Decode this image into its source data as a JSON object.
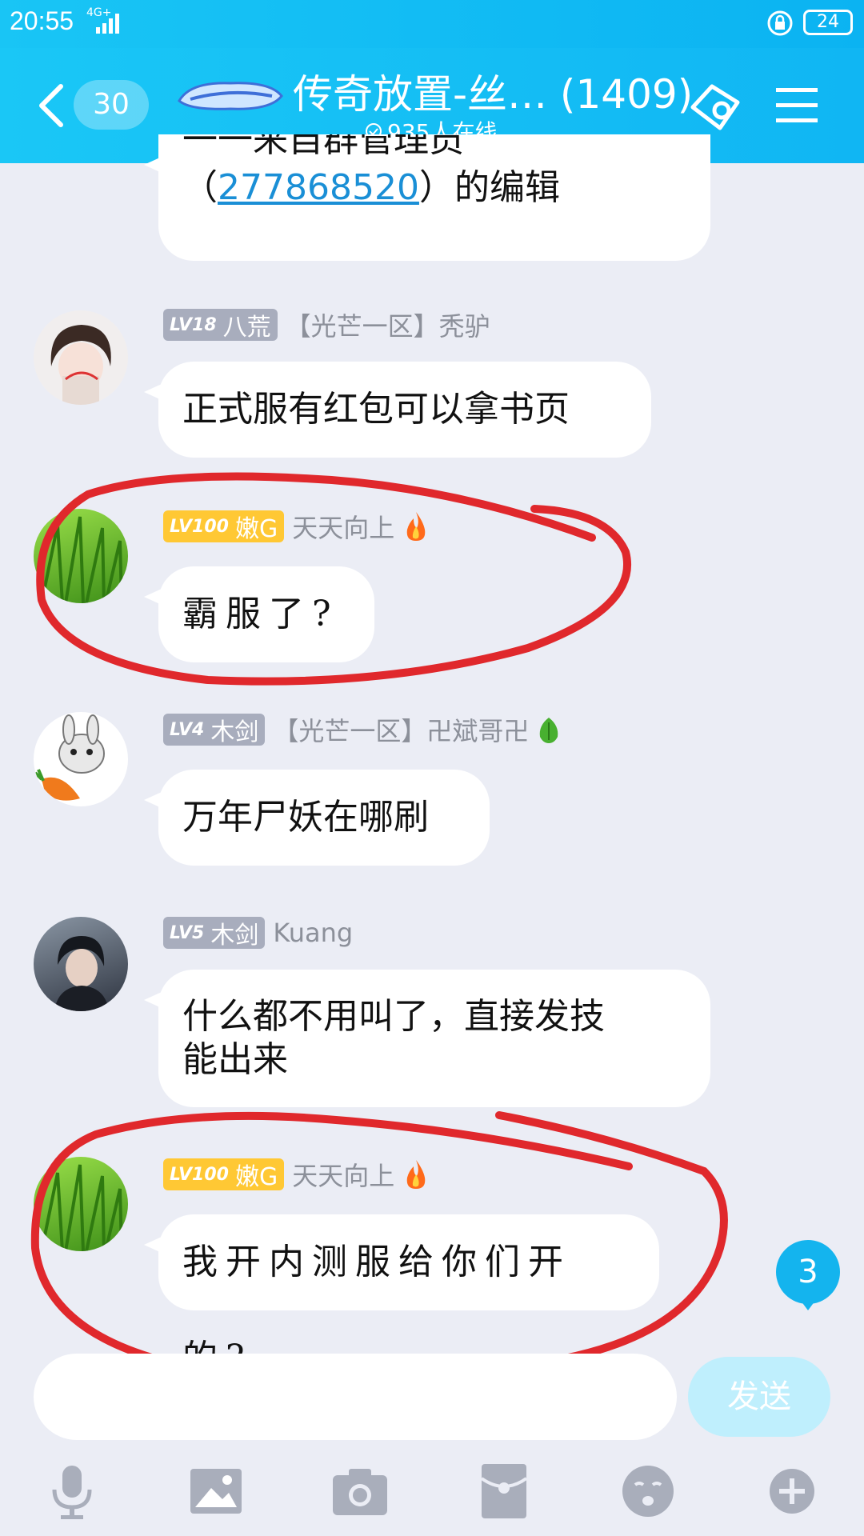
{
  "status": {
    "time": "20:55",
    "network": "4G+",
    "battery": "24"
  },
  "header": {
    "unread_count": "30",
    "title": "传奇放置-丝…  (1409)",
    "online": "935人在线"
  },
  "top_message": {
    "partial_line": "一一来自群管理员",
    "qq": "277868520",
    "suffix": "）的编辑"
  },
  "messages": [
    {
      "level": "LV18",
      "title": "八荒",
      "name": "【光芒一区】秃驴",
      "text": "正式服有红包可以拿书页",
      "badge_color": "#a8adbd"
    },
    {
      "level": "LV100",
      "title": "嫩G",
      "name": "天天向上",
      "text": "霸服了?",
      "badge_color": "#ffc834"
    },
    {
      "level": "LV4",
      "title": "木剑",
      "name": "【光芒一区】卍斌哥卍",
      "text": "万年尸妖在哪刷",
      "badge_color": "#a8adbd"
    },
    {
      "level": "LV5",
      "title": "木剑",
      "name": "Kuang",
      "text_line1": "什么都不用叫了，直接发技",
      "text_line2": "能出来",
      "badge_color": "#a8adbd"
    },
    {
      "level": "LV100",
      "title": "嫩G",
      "name": "天天向上",
      "text": "我开内测服给你们开的?",
      "badge_color": "#ffc834"
    }
  ],
  "new_msg_count": "3",
  "input": {
    "send_label": "发送"
  },
  "toolbar": [
    "mic-icon",
    "image-icon",
    "camera-icon",
    "red-packet-icon",
    "emoji-icon",
    "plus-icon"
  ],
  "colors": {
    "header": "#12bcf4",
    "annotation": "#e0282c"
  }
}
